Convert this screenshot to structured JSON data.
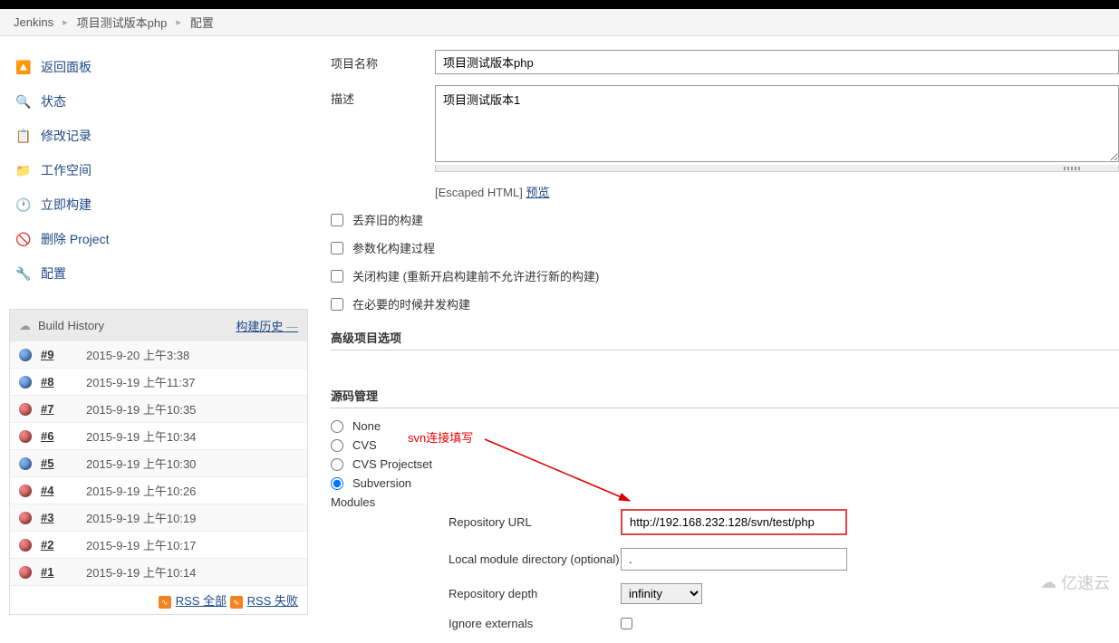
{
  "breadcrumb": {
    "jenkins": "Jenkins",
    "project": "项目测试版本php",
    "config": "配置"
  },
  "sidebar": {
    "items": [
      {
        "label": "返回面板",
        "icon": "up-arrow-icon"
      },
      {
        "label": "状态",
        "icon": "search-icon"
      },
      {
        "label": "修改记录",
        "icon": "clipboard-icon"
      },
      {
        "label": "工作空间",
        "icon": "folder-icon"
      },
      {
        "label": "立即构建",
        "icon": "clock-icon"
      },
      {
        "label": "删除 Project",
        "icon": "forbidden-icon"
      },
      {
        "label": "配置",
        "icon": "wrench-icon"
      }
    ],
    "build_history_title": "Build History",
    "build_history_link": "构建历史",
    "builds": [
      {
        "num": "#9",
        "time": "2015-9-20 上午3:38",
        "status": "blue"
      },
      {
        "num": "#8",
        "time": "2015-9-19 上午11:37",
        "status": "blue"
      },
      {
        "num": "#7",
        "time": "2015-9-19 上午10:35",
        "status": "red"
      },
      {
        "num": "#6",
        "time": "2015-9-19 上午10:34",
        "status": "red"
      },
      {
        "num": "#5",
        "time": "2015-9-19 上午10:30",
        "status": "blue"
      },
      {
        "num": "#4",
        "time": "2015-9-19 上午10:26",
        "status": "red"
      },
      {
        "num": "#3",
        "time": "2015-9-19 上午10:19",
        "status": "red"
      },
      {
        "num": "#2",
        "time": "2015-9-19 上午10:17",
        "status": "red"
      },
      {
        "num": "#1",
        "time": "2015-9-19 上午10:14",
        "status": "red"
      }
    ],
    "rss_all": "RSS 全部",
    "rss_fail": "RSS 失败"
  },
  "form": {
    "project_name_label": "项目名称",
    "project_name_value": "项目测试版本php",
    "desc_label": "描述",
    "desc_value": "项目测试版本1",
    "escaped_html": "[Escaped HTML]",
    "preview": "预览",
    "checkboxes": [
      "丢弃旧的构建",
      "参数化构建过程",
      "关闭构建 (重新开启构建前不允许进行新的构建)",
      "在必要的时候并发构建"
    ],
    "advanced_section": "高级项目选项",
    "scm_section": "源码管理",
    "scm_options": [
      "None",
      "CVS",
      "CVS Projectset",
      "Subversion"
    ],
    "scm_selected": 3,
    "modules_label": "Modules",
    "annotation": "svn连接填写",
    "repo_url_label": "Repository URL",
    "repo_url_value": "http://192.168.232.128/svn/test/php",
    "local_dir_label": "Local module directory (optional)",
    "local_dir_value": ".",
    "repo_depth_label": "Repository depth",
    "repo_depth_value": "infinity",
    "ignore_externals_label": "Ignore externals"
  },
  "watermark": "亿速云"
}
